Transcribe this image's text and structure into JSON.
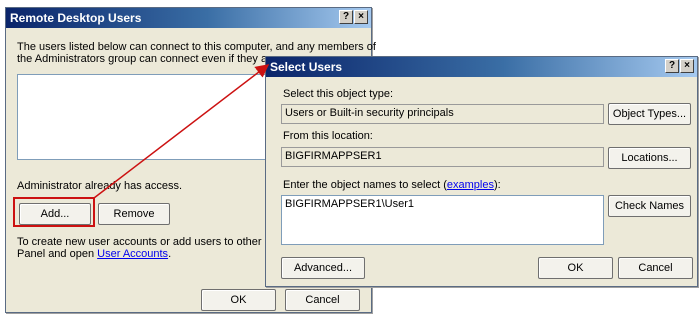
{
  "rdu": {
    "title": "Remote Desktop Users",
    "help_glyph": "?",
    "close_glyph": "×",
    "intro_line1": "The users listed below can connect to this computer, and any members of",
    "intro_line2": "the Administrators group can connect even if they are n",
    "access_note": "Administrator already has access.",
    "add_label": "Add...",
    "remove_label": "Remove",
    "create_line1": "To create new user accounts or add users to other gro",
    "create_line2_prefix": "Panel and open ",
    "user_accounts_link": "User Accounts",
    "create_line2_suffix": ".",
    "ok_label": "OK",
    "cancel_label": "Cancel"
  },
  "select_users": {
    "title": "Select Users",
    "help_glyph": "?",
    "close_glyph": "×",
    "object_type_label": "Select this object type:",
    "object_type_value": "Users or Built-in security principals",
    "object_types_button": "Object Types...",
    "location_label": "From this location:",
    "location_value": "BIGFIRMAPPSER1",
    "locations_button": "Locations...",
    "names_label_prefix": "Enter the object names to select (",
    "examples_link": "examples",
    "names_label_suffix": "):",
    "names_value": "BIGFIRMAPPSER1\\User1",
    "check_names_button": "Check Names",
    "advanced_button": "Advanced...",
    "ok_label": "OK",
    "cancel_label": "Cancel"
  },
  "colors": {
    "callout_red": "#cc1111",
    "title_blue": "#0a246a"
  }
}
